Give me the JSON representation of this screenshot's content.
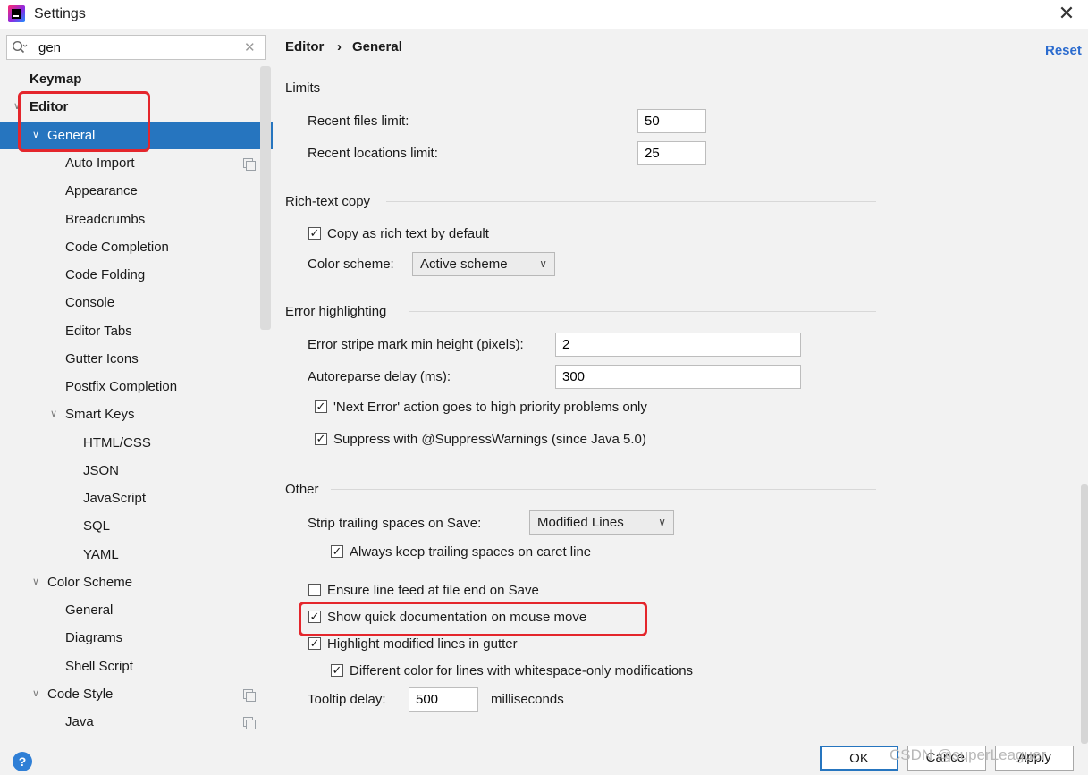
{
  "window": {
    "title": "Settings"
  },
  "search": {
    "value": "gen"
  },
  "tree": [
    {
      "label": "Keymap",
      "bold": true
    },
    {
      "label": "Editor",
      "bold": true
    },
    {
      "label": "General",
      "selected": true
    },
    {
      "label": "Auto Import"
    },
    {
      "label": "Appearance"
    },
    {
      "label": "Breadcrumbs"
    },
    {
      "label": "Code Completion"
    },
    {
      "label": "Code Folding"
    },
    {
      "label": "Console"
    },
    {
      "label": "Editor Tabs"
    },
    {
      "label": "Gutter Icons"
    },
    {
      "label": "Postfix Completion"
    },
    {
      "label": "Smart Keys"
    },
    {
      "label": "HTML/CSS"
    },
    {
      "label": "JSON"
    },
    {
      "label": "JavaScript"
    },
    {
      "label": "SQL"
    },
    {
      "label": "YAML"
    },
    {
      "label": "Color Scheme"
    },
    {
      "label": "General"
    },
    {
      "label": "Diagrams"
    },
    {
      "label": "Shell Script"
    },
    {
      "label": "Code Style"
    },
    {
      "label": "Java"
    }
  ],
  "breadcrumb": {
    "parent": "Editor",
    "separator": "›",
    "current": "General"
  },
  "reset_label": "Reset",
  "limits": {
    "title": "Limits",
    "recent_files_label": "Recent files limit:",
    "recent_files_value": "50",
    "recent_locations_label": "Recent locations limit:",
    "recent_locations_value": "25"
  },
  "rich_text": {
    "title": "Rich-text copy",
    "copy_label": "Copy as rich text by default",
    "copy_checked": true,
    "scheme_label": "Color scheme:",
    "scheme_value": "Active scheme"
  },
  "error_highlighting": {
    "title": "Error highlighting",
    "stripe_label": "Error stripe mark min height (pixels):",
    "stripe_value": "2",
    "autoreparse_label": "Autoreparse delay (ms):",
    "autoreparse_value": "300",
    "next_error_label": "'Next Error' action goes to high priority problems only",
    "next_error_checked": true,
    "suppress_label": "Suppress with @SuppressWarnings (since Java 5.0)",
    "suppress_checked": true
  },
  "other": {
    "title": "Other",
    "strip_label": "Strip trailing spaces on Save:",
    "strip_value": "Modified Lines",
    "keep_trailing_label": "Always keep trailing spaces on caret line",
    "keep_trailing_checked": true,
    "line_feed_label": "Ensure line feed at file end on Save",
    "line_feed_checked": false,
    "quick_doc_label": "Show quick documentation on mouse move",
    "quick_doc_checked": true,
    "highlight_modified_label": "Highlight modified lines in gutter",
    "highlight_modified_checked": true,
    "diff_color_label": "Different color for lines with whitespace-only modifications",
    "diff_color_checked": true,
    "tooltip_label": "Tooltip delay:",
    "tooltip_value": "500",
    "tooltip_unit": "milliseconds"
  },
  "buttons": {
    "ok": "OK",
    "cancel": "Cancel",
    "apply": "Apply"
  },
  "help_glyph": "?",
  "watermark": "CSDN @superLeaguer",
  "colors": {
    "selection": "#2675bf",
    "link": "#2c6ccf",
    "highlight_box": "#e4262c"
  }
}
